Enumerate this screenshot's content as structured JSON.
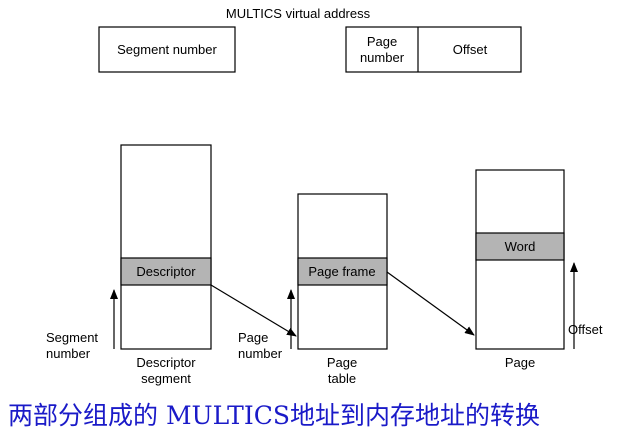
{
  "virtual_address": {
    "title": "MULTICS virtual address",
    "segment_number": "Segment number",
    "page_number_line1": "Page",
    "page_number_line2": "number",
    "offset": "Offset"
  },
  "descriptor_segment": {
    "entry": "Descriptor",
    "caption_line1": "Descriptor",
    "caption_line2": "segment",
    "index_line1": "Segment",
    "index_line2": "number"
  },
  "page_table": {
    "entry": "Page frame",
    "caption_line1": "Page",
    "caption_line2": "table",
    "index_line1": "Page",
    "index_line2": "number"
  },
  "page": {
    "entry": "Word",
    "caption": "Page",
    "index": "Offset"
  },
  "caption": {
    "text": "两部分组成的 MULTICS地址到内存地址的转换",
    "color": "#1a1ac8"
  },
  "colors": {
    "line": "#000000",
    "highlight": "#b4b4b4",
    "background": "#ffffff"
  }
}
